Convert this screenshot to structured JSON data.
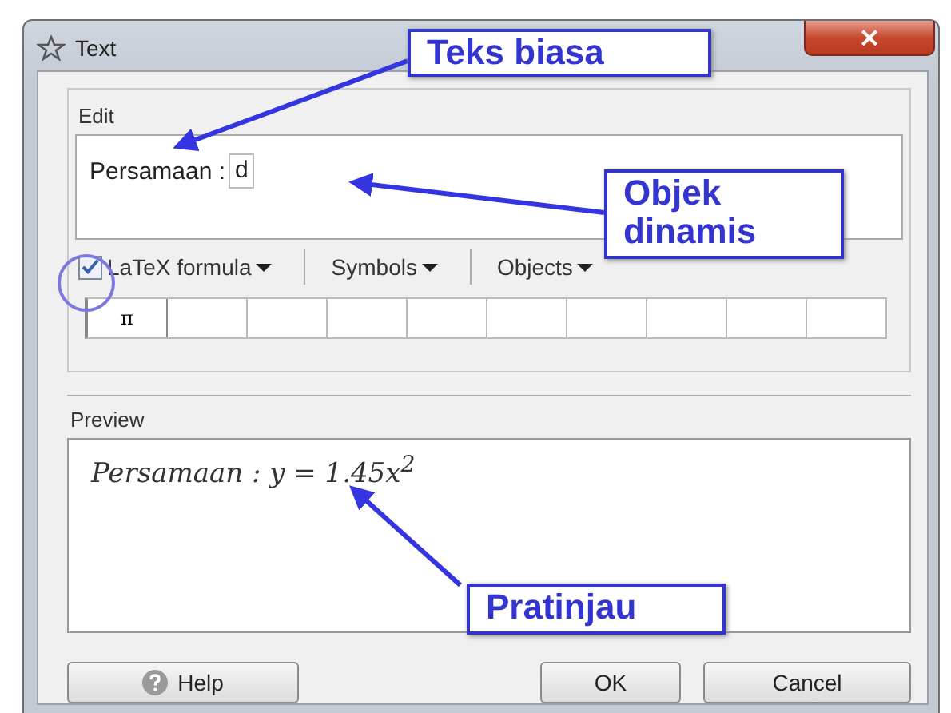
{
  "window": {
    "title": "Text",
    "close": "×"
  },
  "edit": {
    "label": "Edit",
    "text": "Persamaan :",
    "object": "d"
  },
  "toolbar": {
    "latex": {
      "label": "LaTeX formula",
      "checked": true
    },
    "menus": [
      "Symbols",
      "Objects"
    ]
  },
  "symbols": [
    "π"
  ],
  "preview": {
    "label": "Preview",
    "formula": "Persamaan : y = 1.45x$^{2}$"
  },
  "buttons": [
    {
      "label": "Help",
      "kind": "help"
    },
    {
      "label": "OK",
      "kind": "plain"
    },
    {
      "label": "Cancel",
      "kind": "plain"
    }
  ],
  "annotations": [
    {
      "kind": "callout",
      "text": "Teks biasa"
    },
    {
      "kind": "callout",
      "text": "Objek dinamis"
    },
    {
      "kind": "circle"
    },
    {
      "kind": "callout",
      "text": "Pratinjau"
    }
  ]
}
